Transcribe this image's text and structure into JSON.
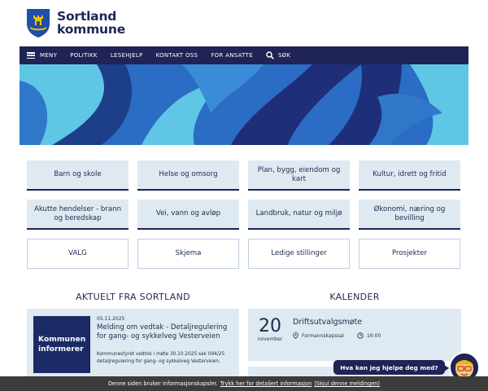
{
  "brand": {
    "line1": "Sortland",
    "line2": "kommune"
  },
  "nav": {
    "menu_label": "MENY",
    "items": [
      "POLITIKK",
      "LESEHJELP",
      "KONTAKT OSS",
      "FOR ANSATTE"
    ],
    "search_label": "SØK",
    "icons": {
      "menu": "hamburger-icon",
      "search": "search-icon"
    }
  },
  "tiles": [
    {
      "label": "Barn og skole"
    },
    {
      "label": "Helse og omsorg"
    },
    {
      "label": "Plan, bygg, eiendom og kart"
    },
    {
      "label": "Kultur, idrett og fritid"
    },
    {
      "label": "Akutte hendelser - brann og beredskap"
    },
    {
      "label": "Vei, vann og avløp"
    },
    {
      "label": "Landbruk, natur og miljø"
    },
    {
      "label": "Økonomi, næring og bevilling"
    },
    {
      "label": "VALG"
    },
    {
      "label": "Skjema"
    },
    {
      "label": "Ledige stillinger"
    },
    {
      "label": "Prosjekter"
    }
  ],
  "news": {
    "section_title": "AKTUELT FRA SORTLAND",
    "item": {
      "image_line1": "Kommunen",
      "image_line2": "informerer",
      "date": "05.11.2025",
      "title": "Melding om vedtak - Detaljregulering for gang- og sykkelveg Vesterveien",
      "excerpt": "Kommunestyret vedtok i møte 30.10.2025 sak 094/25 detaljregulering for gang- og sykkelveg Vesterveien."
    }
  },
  "calendar": {
    "section_title": "KALENDER",
    "event": {
      "day": "20",
      "month": "november",
      "title": "Driftsutvalgsmøte",
      "location": "Formannskapssal",
      "time": "10:00"
    }
  },
  "chat": {
    "prompt": "Hva kan jeg hjelpe deg med?"
  },
  "cookie": {
    "text": "Denne siden bruker informasjonskapsler.",
    "details_link": "Trykk her for detaljert informasjon",
    "hide_link": "(Skjul denne meldingen)"
  },
  "colors": {
    "navy": "#1f2355",
    "tile_bg": "#dfe9f2",
    "hero_blue": "#2b6cc4",
    "hero_light": "#5fc6e6",
    "cookie_bg": "#3c3c3c"
  }
}
